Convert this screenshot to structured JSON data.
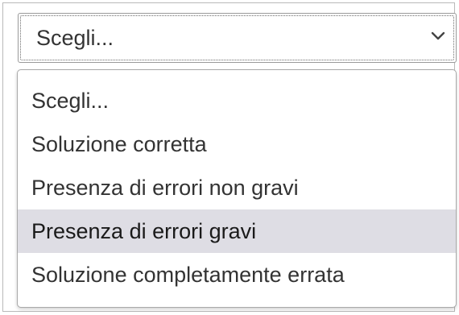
{
  "select": {
    "value": "Scegli...",
    "chevron_icon": "chevron-down-icon"
  },
  "dropdown": {
    "highlighted_index": 3,
    "highlight_color": "#dedde4",
    "options": [
      {
        "label": "Scegli..."
      },
      {
        "label": "Soluzione corretta"
      },
      {
        "label": "Presenza di errori non gravi"
      },
      {
        "label": "Presenza di errori gravi"
      },
      {
        "label": "Soluzione completamente errata"
      }
    ]
  }
}
